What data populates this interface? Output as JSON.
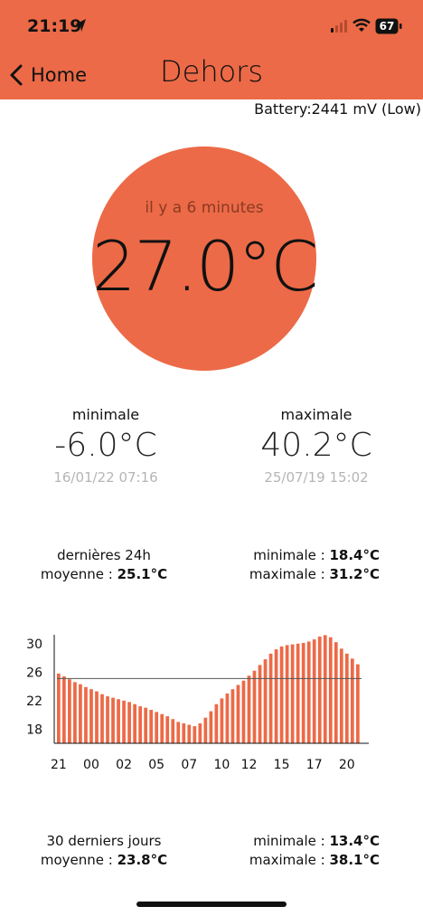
{
  "status_bar": {
    "time": "21:19",
    "battery_level": "67"
  },
  "nav": {
    "back_label": "Home",
    "title": "Dehors"
  },
  "sensor": {
    "battery": "Battery:2441 mV (Low)",
    "updated": "il y a 6 minutes",
    "temperature": "27.0°C"
  },
  "records": {
    "min": {
      "label": "minimale",
      "value": "-6.0°C",
      "date": "16/01/22 07:16"
    },
    "max": {
      "label": "maximale",
      "value": "40.2°C",
      "date": "25/07/19 15:02"
    }
  },
  "last_24h": {
    "title": "dernières 24h",
    "avg_label": "moyenne : ",
    "avg_value": "25.1°C",
    "min_label": "minimale : ",
    "min_value": "18.4°C",
    "max_label": "maximale : ",
    "max_value": "31.2°C"
  },
  "last_30d": {
    "title": "30 derniers jours",
    "avg_label": "moyenne : ",
    "avg_value": "23.8°C",
    "min_label": "minimale : ",
    "min_value": "13.4°C",
    "max_label": "maximale : ",
    "max_value": "38.1°C"
  },
  "colors": {
    "accent": "#ec6a47",
    "muted_text": "#b5b5b5",
    "average_line": "#555555"
  },
  "chart_data": {
    "type": "bar",
    "ylim": [
      16,
      31.5
    ],
    "yticks": [
      30,
      26,
      22,
      18
    ],
    "xticks": [
      {
        "label": "21",
        "index": 0
      },
      {
        "label": "00",
        "index": 6
      },
      {
        "label": "02",
        "index": 12
      },
      {
        "label": "05",
        "index": 18
      },
      {
        "label": "07",
        "index": 24
      },
      {
        "label": "10",
        "index": 30
      },
      {
        "label": "12",
        "index": 35
      },
      {
        "label": "15",
        "index": 41
      },
      {
        "label": "17",
        "index": 47
      },
      {
        "label": "20",
        "index": 53
      }
    ],
    "average": 25.1,
    "values": [
      25.8,
      25.4,
      25.0,
      24.6,
      24.3,
      23.9,
      23.6,
      23.3,
      22.9,
      22.6,
      22.4,
      22.2,
      22.0,
      21.8,
      21.5,
      21.2,
      21.0,
      20.7,
      20.4,
      20.1,
      19.8,
      19.4,
      19.0,
      18.8,
      18.6,
      18.4,
      18.8,
      19.6,
      20.5,
      21.5,
      22.3,
      23.0,
      23.6,
      24.2,
      24.8,
      25.5,
      26.2,
      27.0,
      27.8,
      28.6,
      29.2,
      29.6,
      29.8,
      29.9,
      30.0,
      30.1,
      30.3,
      30.6,
      31.0,
      31.2,
      30.9,
      30.2,
      29.3,
      28.6,
      27.9,
      27.1
    ]
  }
}
